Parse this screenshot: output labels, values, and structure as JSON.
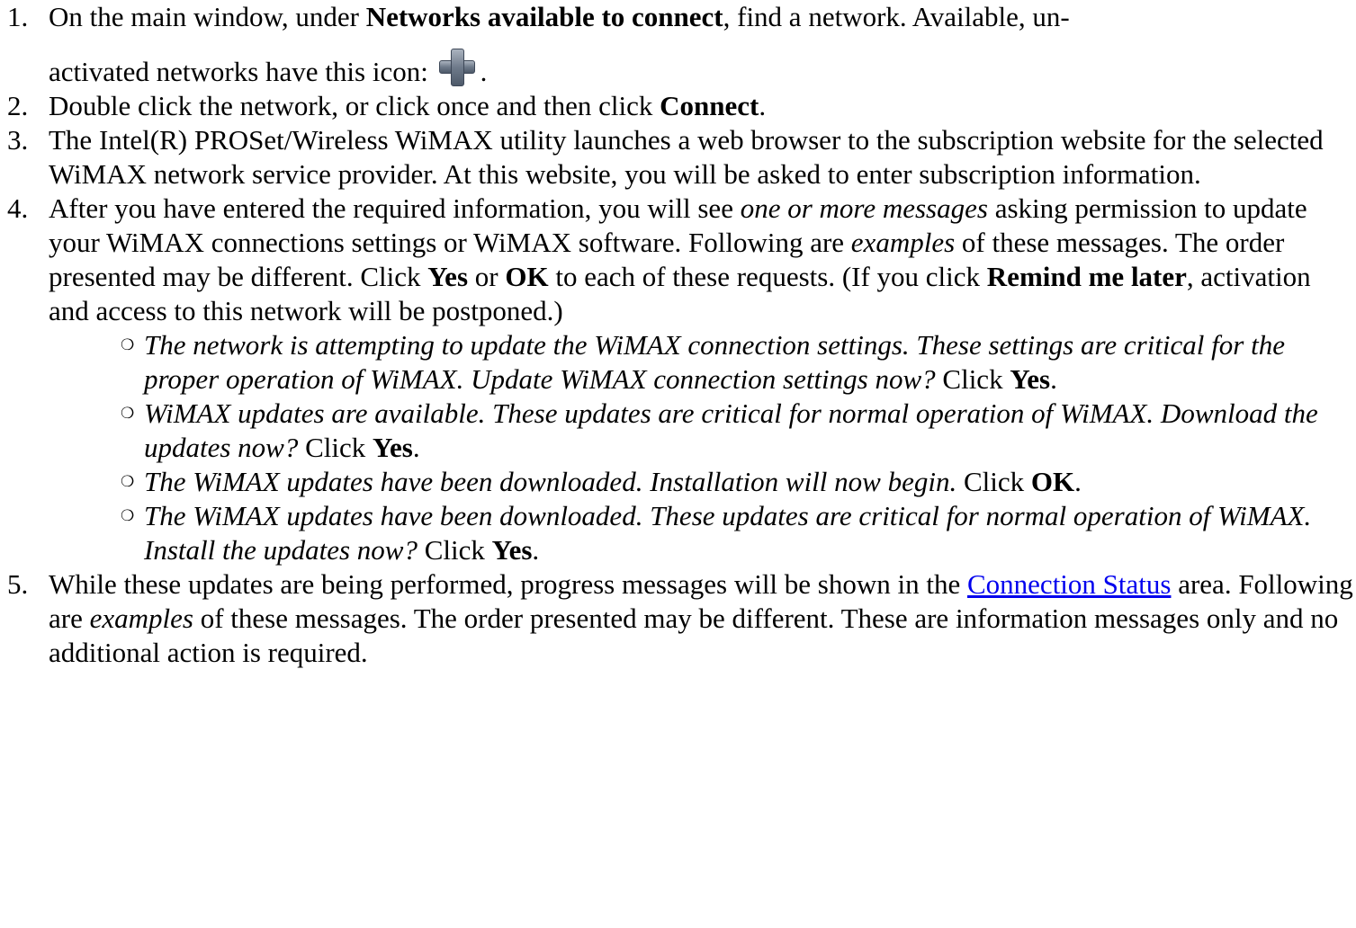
{
  "steps": [
    {
      "num": "1.",
      "t1": "On the main window, under ",
      "b1": "Networks available to connect",
      "t2": ", find a network. Available, un-",
      "t3": "activated networks have this icon: ",
      "t4": "."
    },
    {
      "num": "2.",
      "t1": "Double click the network, or click once and then click ",
      "b1": "Connect",
      "t2": "."
    },
    {
      "num": "3.",
      "t1": "The Intel(R) PROSet/Wireless WiMAX utility launches a web browser to the subscription website for the selected WiMAX network service provider. At this website, you will be asked to enter subscription information."
    },
    {
      "num": "4.",
      "t1": "After you have entered the required information, you will see ",
      "i1": "one or more messages",
      "t2": " asking permission to update your WiMAX connections settings or WiMAX software. Following are ",
      "i2": "examples",
      "t3": " of these messages. The order presented may be different. Click ",
      "b1": "Yes",
      "t4": " or ",
      "b2": "OK",
      "t5": " to each of these requests. (If you click ",
      "b3": "Remind me later",
      "t6": ", activation and access to this network will be postponed.)",
      "messages": [
        {
          "italic": "The network is attempting to update the WiMAX connection settings. These settings are critical for the proper operation of WiMAX. Update WiMAX connection settings now?",
          "click": " Click ",
          "button": "Yes",
          "end": "."
        },
        {
          "italic": "WiMAX updates are available. These updates are critical for normal operation of WiMAX. Download the updates now?",
          "click": " Click ",
          "button": "Yes",
          "end": "."
        },
        {
          "italic": "The WiMAX updates have been downloaded. Installation will now begin.",
          "click": " Click ",
          "button": "OK",
          "end": "."
        },
        {
          "italic": "The WiMAX updates have been downloaded. These updates are critical for normal operation of WiMAX. Install the updates now?",
          "click": " Click ",
          "button": "Yes",
          "end": "."
        }
      ]
    },
    {
      "num": "5.",
      "t1": "While these updates are being performed, progress messages will be shown in the ",
      "link": "Connection Status",
      "t2": " area. Following are ",
      "i1": "examples",
      "t3": " of these messages. The order presented may be different. These are information messages only and no additional action is required."
    }
  ],
  "icons": {
    "network_icon": "plus-icon",
    "bullet": "❍",
    "link_color": "#0000ee"
  }
}
